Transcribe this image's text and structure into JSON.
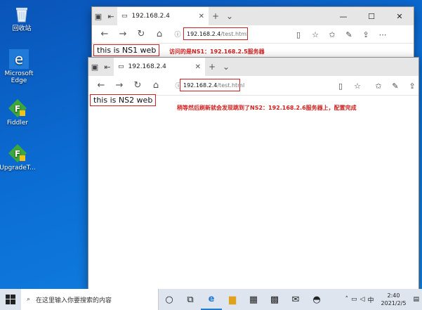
{
  "desktop": {
    "icons": [
      {
        "label": "回收站",
        "icon": "recycle-bin-icon"
      },
      {
        "label": "Microsoft Edge",
        "icon": "edge-icon"
      },
      {
        "label": "Fiddler",
        "icon": "fiddler-icon"
      },
      {
        "label": "UpgradeT...",
        "icon": "fiddler-upgrade-icon"
      }
    ]
  },
  "window_back": {
    "tab_title": "192.168.2.4",
    "address_host": "192.168.2.4",
    "address_path": "/test.html",
    "page_text": "this is NS1 web",
    "annotation": "访问的是NS1：192.168.2.5服务器"
  },
  "window_front": {
    "tab_title": "192.168.2.4",
    "address_host": "192.168.2.4",
    "address_path": "/test.html",
    "page_text": "this is NS2 web",
    "annotation": "稍等然后刷新就会发现跳到了NS2：192.168.2.6服务器上，配置完成"
  },
  "window_controls": {
    "minimize": "—",
    "maximize": "☐",
    "close": "✕"
  },
  "taskbar": {
    "search_placeholder": "在这里输入你要搜索的内容",
    "ime": "中",
    "time": "2:40",
    "date": "2021/2/5"
  },
  "colors": {
    "accent_red": "#d21f1f",
    "desktop_blue": "#0b6fd6"
  }
}
